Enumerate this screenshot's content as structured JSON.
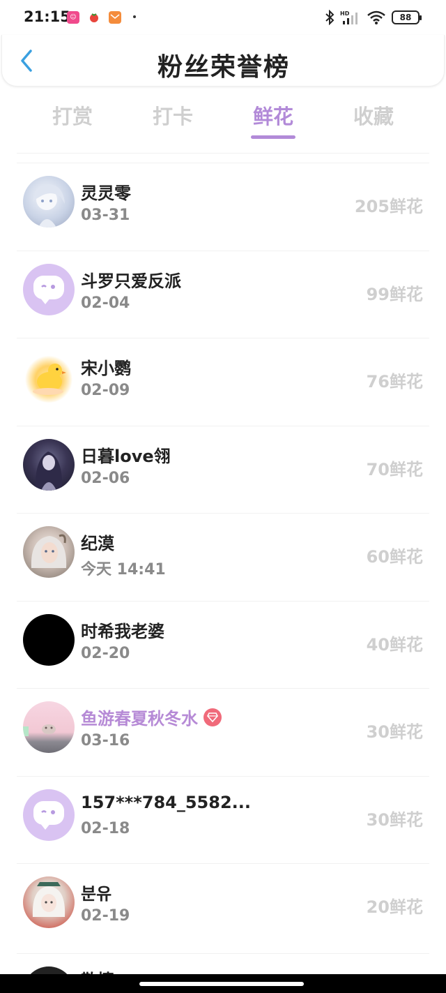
{
  "status": {
    "time": "21:15",
    "battery": "88"
  },
  "header": {
    "title": "粉丝荣誉榜"
  },
  "tabs": [
    {
      "label": "打赏"
    },
    {
      "label": "打卡"
    },
    {
      "label": "鲜花"
    },
    {
      "label": "收藏"
    }
  ],
  "active_tab": "鲜花",
  "fans": [
    {
      "name": "灵灵零",
      "date": "03-31",
      "amount": "205鲜花",
      "avatar": "icy-anime-avatar"
    },
    {
      "name": "斗罗只爱反派",
      "date": "02-04",
      "amount": "99鲜花",
      "avatar": "default-chat-avatar"
    },
    {
      "name": "宋小鹦",
      "date": "02-09",
      "amount": "76鲜花",
      "avatar": "chick-avatar"
    },
    {
      "name": "日暮love翎",
      "date": "02-06",
      "amount": "70鲜花",
      "avatar": "dark-anime-avatar"
    },
    {
      "name": "纪漠",
      "date": "今天 14:41",
      "amount": "60鲜花",
      "avatar": "elf-avatar"
    },
    {
      "name": "时希我老婆",
      "date": "02-20",
      "amount": "40鲜花",
      "avatar": "black-avatar"
    },
    {
      "name": "鱼游春夏秋冬水",
      "date": "03-16",
      "amount": "30鲜花",
      "avatar": "pink-avatar",
      "vip": true
    },
    {
      "name": "157***784_5582...",
      "date": "02-18",
      "amount": "30鲜花",
      "avatar": "default-chat-avatar"
    },
    {
      "name": "분유",
      "date": "02-19",
      "amount": "20鲜花",
      "avatar": "girl-avatar"
    }
  ],
  "partial_row": {
    "name": "散情"
  },
  "colors": {
    "accent": "#b28ad8",
    "muted": "#cfcfcf",
    "date": "#8a8a8a"
  }
}
